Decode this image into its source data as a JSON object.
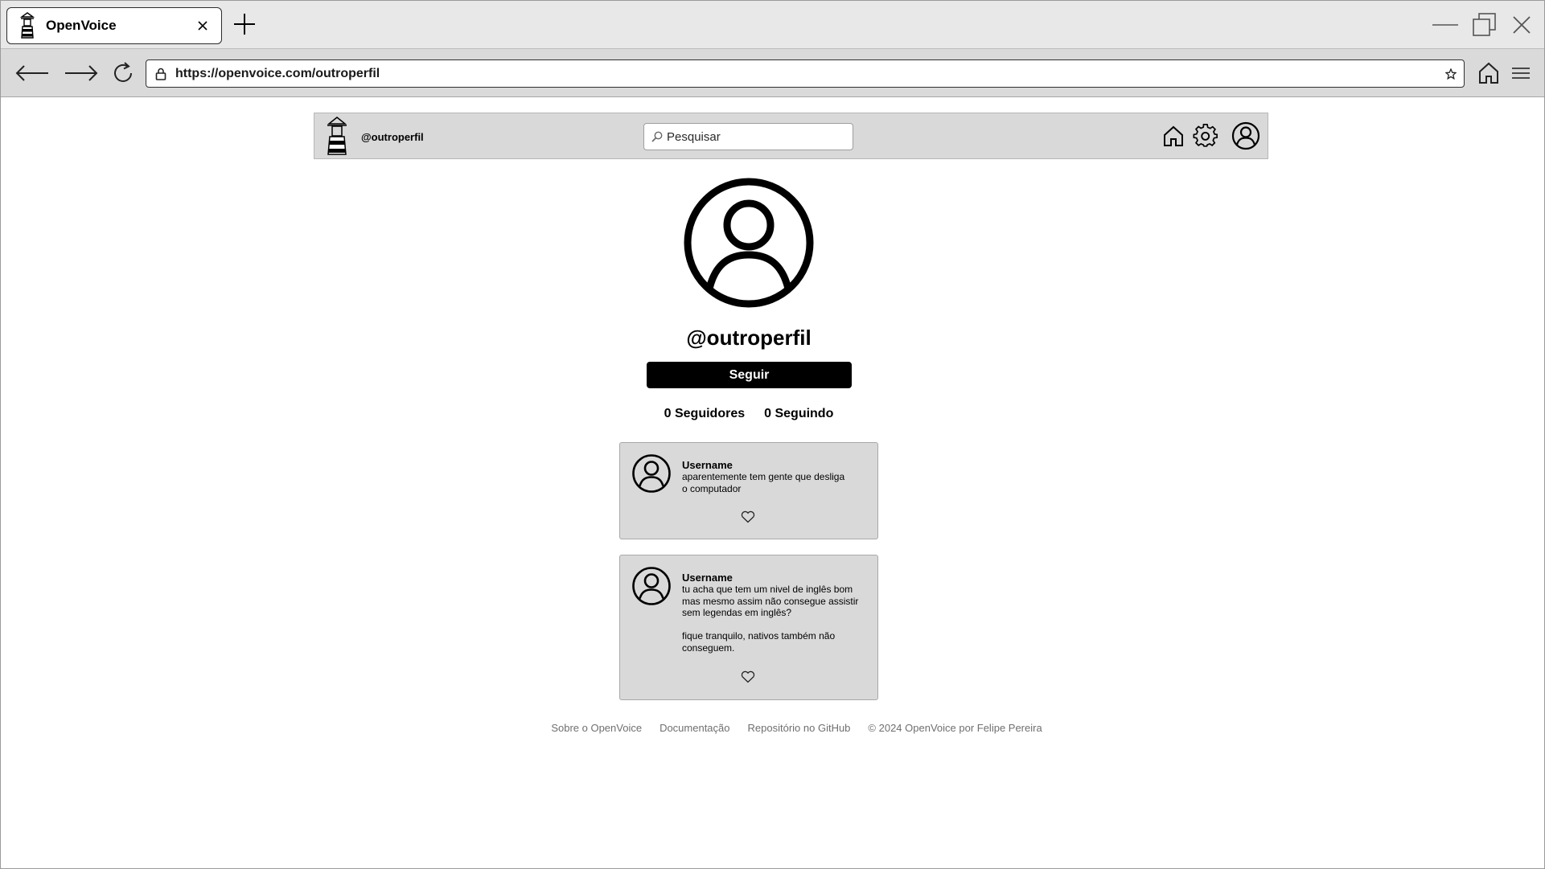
{
  "browser": {
    "tab_title": "OpenVoice",
    "url": "https://openvoice.com/outroperfil"
  },
  "header": {
    "handle": "@outroperfil",
    "search_placeholder": "Pesquisar"
  },
  "profile": {
    "name": "@outroperfil",
    "follow_label": "Seguir",
    "followers": "0 Seguidores",
    "following": "0 Seguindo"
  },
  "posts": [
    {
      "username": "Username",
      "text": "aparentemente tem gente que desliga\no computador"
    },
    {
      "username": "Username",
      "text": "tu acha que tem um nivel de inglês bom\nmas mesmo assim não consegue assistir\nsem legendas em inglês?\n\nfique tranquilo, nativos também não\nconseguem."
    }
  ],
  "footer": {
    "about": "Sobre o OpenVoice",
    "docs": "Documentação",
    "repo": "Repositório no GitHub",
    "copyright": "© 2024 OpenVoice por Felipe Pereira"
  }
}
